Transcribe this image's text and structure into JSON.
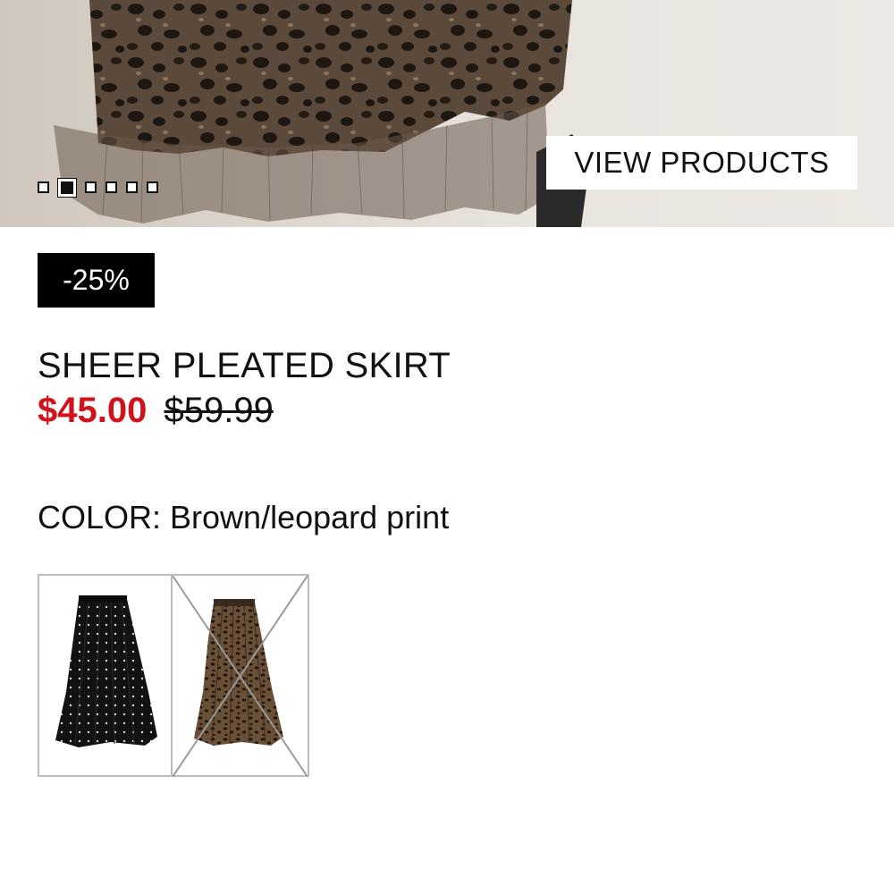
{
  "hero": {
    "view_products_label": "VIEW PRODUCTS",
    "slides": [
      {
        "active": false
      },
      {
        "active": true
      },
      {
        "active": false
      },
      {
        "active": false
      },
      {
        "active": false
      },
      {
        "active": false
      }
    ]
  },
  "product": {
    "discount_badge": "-25%",
    "name": "SHEER PLEATED SKIRT",
    "sale_price": "$45.00",
    "original_price": "$59.99",
    "color_label": "COLOR: Brown/leopard print",
    "swatches": [
      {
        "name": "black-polka-dot",
        "available": true
      },
      {
        "name": "brown-leopard",
        "available": false
      }
    ]
  },
  "colors": {
    "sale_red": "#d0121b",
    "badge_bg": "#000000",
    "swatch_border": "#bdbdbd"
  }
}
